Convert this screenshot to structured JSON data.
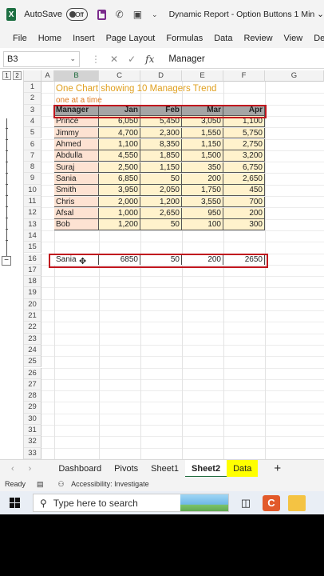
{
  "titlebar": {
    "autosave_label": "AutoSave",
    "toggle_state": "Off",
    "document_title": "Dynamic Report - Option Buttons 1 Min"
  },
  "ribbon": {
    "tabs": [
      "File",
      "Home",
      "Insert",
      "Page Layout",
      "Formulas",
      "Data",
      "Review",
      "View",
      "Develo"
    ]
  },
  "formula_bar": {
    "name_box": "B3",
    "fx_label": "fx",
    "value": "Manager"
  },
  "outline": {
    "level1": "1",
    "level2": "2",
    "collapse": "−"
  },
  "columns": [
    "A",
    "B",
    "C",
    "D",
    "E",
    "F",
    "G"
  ],
  "rows": [
    "1",
    "2",
    "3",
    "4",
    "5",
    "6",
    "7",
    "8",
    "9",
    "10",
    "11",
    "12",
    "13",
    "14",
    "15",
    "16",
    "17",
    "18",
    "19",
    "20",
    "21",
    "22",
    "23",
    "24",
    "25",
    "26",
    "27",
    "28",
    "29",
    "30",
    "31",
    "32",
    "33"
  ],
  "sheet": {
    "title": "One Chart showing 10 Managers Trend",
    "subtitle": "one at a time",
    "headers": [
      "Manager",
      "Jan",
      "Feb",
      "Mar",
      "Apr"
    ],
    "data": [
      [
        "Prince",
        "6,050",
        "5,450",
        "3,050",
        "1,100"
      ],
      [
        "Jimmy",
        "4,700",
        "2,300",
        "1,550",
        "5,750"
      ],
      [
        "Ahmed",
        "1,100",
        "8,350",
        "1,150",
        "2,750"
      ],
      [
        "Abdulla",
        "4,550",
        "1,850",
        "1,500",
        "3,200"
      ],
      [
        "Suraj",
        "2,500",
        "1,150",
        "350",
        "6,750"
      ],
      [
        "Sania",
        "6,850",
        "50",
        "200",
        "2,650"
      ],
      [
        "Smith",
        "3,950",
        "2,050",
        "1,750",
        "450"
      ],
      [
        "Chris",
        "2,000",
        "1,200",
        "3,550",
        "700"
      ],
      [
        "Afsal",
        "1,000",
        "2,650",
        "950",
        "200"
      ],
      [
        "Bob",
        "1,200",
        "50",
        "100",
        "300"
      ]
    ],
    "selected_row": [
      "Sania",
      "6850",
      "50",
      "200",
      "2650"
    ]
  },
  "sheet_tabs": {
    "tabs": [
      "Dashboard",
      "Pivots",
      "Sheet1",
      "Sheet2",
      "Data"
    ],
    "active": "Sheet2",
    "add": "+"
  },
  "status": {
    "ready": "Ready",
    "accessibility": "Accessibility: Investigate"
  },
  "taskbar": {
    "search_placeholder": "Type here to search"
  },
  "colors": {
    "accent_green": "#1e6b3c",
    "header_gray": "#a5a5a5",
    "name_col_bg": "#fde2d2",
    "data_bg": "#fff2cc",
    "red_highlight": "#c0161e",
    "title_color": "#e0a020",
    "tab_highlight": "#ffff00"
  },
  "icons": [
    "excel-logo-icon",
    "save-icon",
    "phone-icon",
    "image-icon",
    "chevron-down-icon",
    "check-icon",
    "close-icon",
    "search-icon",
    "windows-logo-icon",
    "cursor-icon"
  ]
}
